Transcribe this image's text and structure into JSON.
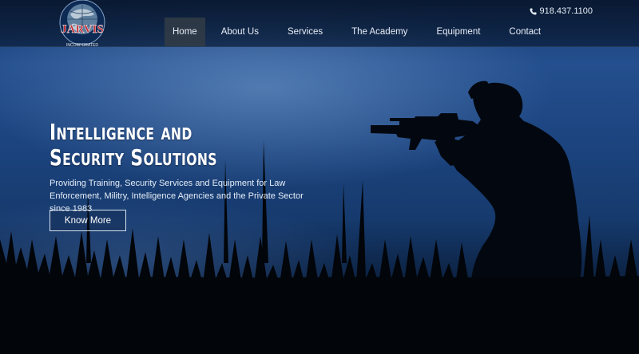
{
  "brand": {
    "logo_text": "JARVIS",
    "logo_subtext": "INCORPORATED"
  },
  "header": {
    "phone": "918.437.1100",
    "phone_icon": "phone-icon"
  },
  "nav": {
    "items": [
      {
        "label": "Home",
        "active": true
      },
      {
        "label": "About Us",
        "active": false
      },
      {
        "label": "Services",
        "active": false
      },
      {
        "label": "The Academy",
        "active": false
      },
      {
        "label": "Equipment",
        "active": false
      },
      {
        "label": "Contact",
        "active": false
      }
    ]
  },
  "hero": {
    "headline_line1": "Intelligence and",
    "headline_line2": "Security Solutions",
    "subtext": "Providing Training, Security Services and Equipment for Law Enforcement, Militry, Intelligence Agencies and the Private Sector since 1983",
    "cta_label": "Know More"
  },
  "colors": {
    "accent": "#c1272d",
    "nav_active_bg": "#32404a",
    "sky_mid": "#1c447f"
  }
}
